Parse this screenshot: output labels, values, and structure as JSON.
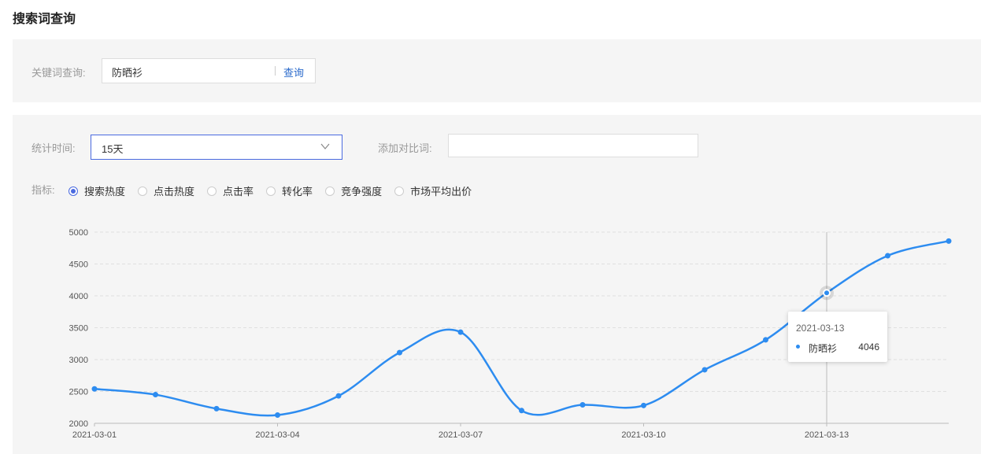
{
  "page": {
    "title": "搜索词查询"
  },
  "search": {
    "label": "关键词查询:",
    "value": "防晒衫",
    "button": "查询"
  },
  "filters": {
    "period_label": "统计时间:",
    "period_value": "15天",
    "compare_label": "添加对比词:",
    "compare_value": "",
    "metric_label": "指标:",
    "metrics": [
      "搜索热度",
      "点击热度",
      "点击率",
      "转化率",
      "竞争强度",
      "市场平均出价"
    ],
    "selected_metric": "搜索热度"
  },
  "colors": {
    "accent": "#4a6ae0",
    "series": "#2d8cf0",
    "link": "#2a6acb"
  },
  "chart_data": {
    "type": "line",
    "x": [
      "2021-03-01",
      "2021-03-02",
      "2021-03-03",
      "2021-03-04",
      "2021-03-05",
      "2021-03-06",
      "2021-03-07",
      "2021-03-08",
      "2021-03-09",
      "2021-03-10",
      "2021-03-11",
      "2021-03-12",
      "2021-03-13",
      "2021-03-14",
      "2021-03-15"
    ],
    "xtick_labels": [
      "2021-03-01",
      "2021-03-04",
      "2021-03-07",
      "2021-03-10",
      "2021-03-13"
    ],
    "series": [
      {
        "name": "防晒衫",
        "values": [
          2540,
          2450,
          2230,
          2130,
          2430,
          3110,
          3430,
          2200,
          2290,
          2280,
          2840,
          3310,
          4046,
          4630,
          4860
        ]
      }
    ],
    "ylim": [
      2000,
      5000
    ],
    "yticks": [
      2000,
      2500,
      3000,
      3500,
      4000,
      4500,
      5000
    ],
    "grid": true,
    "xlabel": "",
    "ylabel": ""
  },
  "tooltip": {
    "date": "2021-03-13",
    "series": "防晒衫",
    "value": "4046"
  }
}
